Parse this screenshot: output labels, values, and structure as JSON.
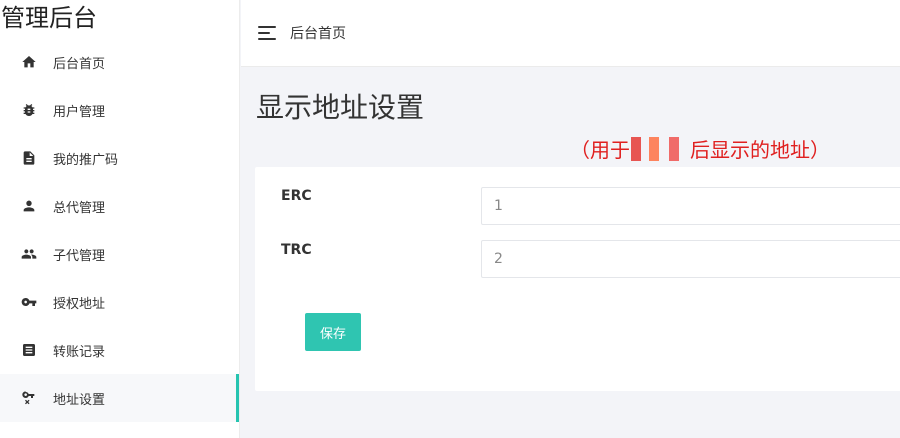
{
  "app": {
    "title": "管理后台"
  },
  "sidebar": {
    "items": [
      {
        "label": "后台首页",
        "icon": "home-icon"
      },
      {
        "label": "用户管理",
        "icon": "bug-icon"
      },
      {
        "label": "我的推广码",
        "icon": "document-icon"
      },
      {
        "label": "总代管理",
        "icon": "person-icon"
      },
      {
        "label": "子代管理",
        "icon": "people-icon"
      },
      {
        "label": "授权地址",
        "icon": "key-icon"
      },
      {
        "label": "转账记录",
        "icon": "list-icon"
      },
      {
        "label": "地址设置",
        "icon": "key-settings-icon",
        "active": true
      }
    ]
  },
  "topbar": {
    "breadcrumb": "后台首页"
  },
  "main": {
    "title": "显示地址设置",
    "annotation_prefix": "（用于",
    "annotation_suffix": "后显示的地址）",
    "form": {
      "erc_label": "ERC",
      "erc_value": "1",
      "trc_label": "TRC",
      "trc_value": "2",
      "save_label": "保存"
    }
  },
  "colors": {
    "accent": "#2fc5b1",
    "annotation": "#e02020",
    "background": "#f3f4f8"
  }
}
